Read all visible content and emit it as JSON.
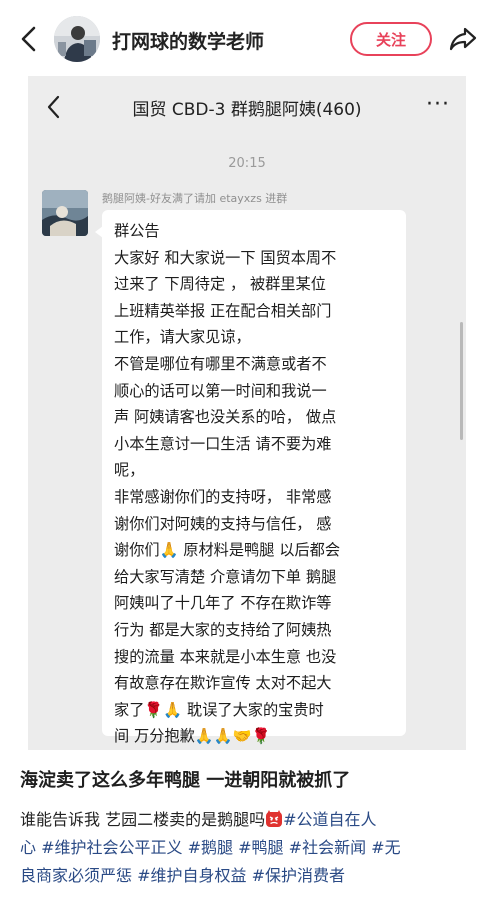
{
  "topbar": {
    "author_name": "打网球的数学老师",
    "follow_label": "关注"
  },
  "chat": {
    "title": "国贸 CBD-3 群鹅腿阿姨(460)",
    "more": "···",
    "time": "20:15",
    "sender": "鹅腿阿姨-好友满了请加 etayxzs 进群",
    "message_lines": [
      "群公告",
      "大家好  和大家说一下 国贸本周不",
      "过来了 下周待定  ，  被群里某位",
      "上班精英举报 正在配合相关部门",
      "工作，请大家见谅，",
      "不管是哪位有哪里不满意或者不",
      "顺心的话可以第一时间和我说一",
      "声 阿姨请客也没关系的哈，  做点",
      "小本生意讨一口生活 请不要为难",
      "呢，",
      "非常感谢你们的支持呀，  非常感",
      "谢你们对阿姨的支持与信任，  感",
      "谢你们🙏 原材料是鸭腿 以后都会",
      "给大家写清楚  介意请勿下单 鹅腿",
      "阿姨叫了十几年了 不存在欺诈等",
      "行为 都是大家的支持给了阿姨热",
      "搜的流量  本来就是小本生意 也没",
      "有故意存在欺诈宣传 太对不起大",
      "家了🌹🙏  耽误了大家的宝贵时",
      "间 万分抱歉🙏🙏🤝🌹"
    ]
  },
  "post": {
    "title": "海淀卖了这么多年鸭腿 一进朝阳就被抓了",
    "line1_text": "谁能告诉我 艺园二楼卖的是鹅腿吗",
    "line1_tag": "#公道自在人",
    "line2_tag1": "心",
    "line2_tag2": "#维护社会公平正义",
    "line2_tag3": "#鹅腿",
    "line2_tag4": "#鸭腿",
    "line2_tag5": "#社会新闻",
    "line2_tag6": "#无",
    "line3_tag1": "良商家必须严惩",
    "line3_tag2": "#维护自身权益",
    "line3_tag3": "#保护消费者"
  },
  "colors": {
    "accent": "#e8425a",
    "tag": "#2a4a85",
    "chat_bg": "#ececec"
  },
  "icons": {
    "back": "back-arrow-icon",
    "share": "share-icon",
    "chat_back": "chevron-left-icon",
    "more": "more-dots-icon",
    "devil": "angry-devil-emoji-icon"
  }
}
